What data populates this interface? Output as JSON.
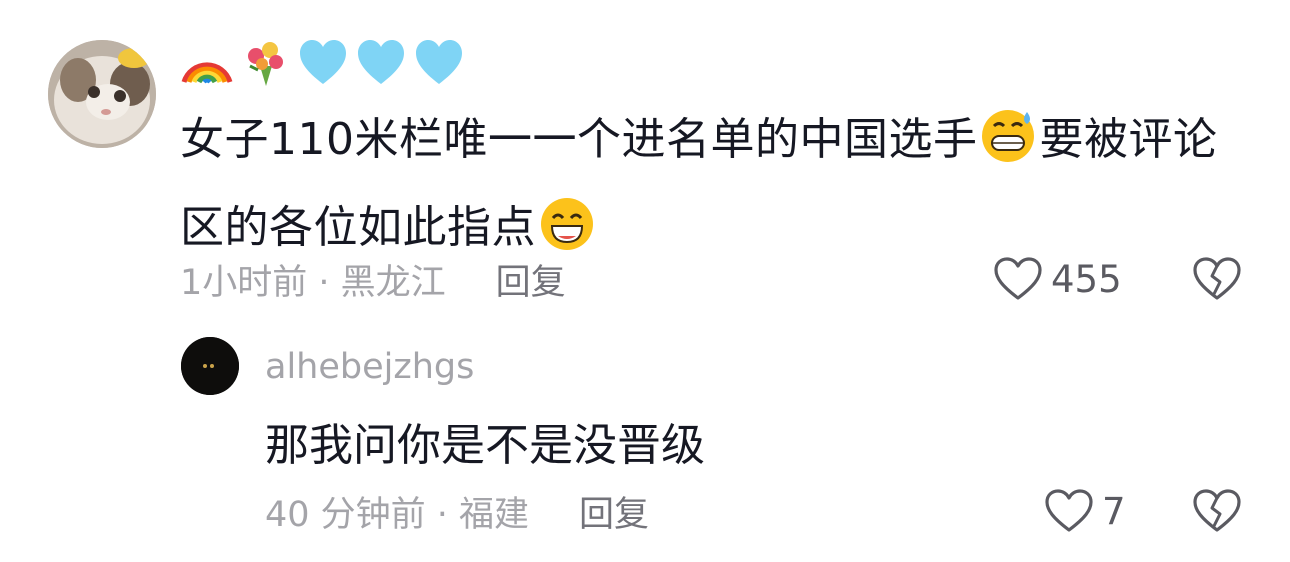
{
  "comment": {
    "avatar_icon": "cat-avatar-icon",
    "emoji_line": [
      "rainbow-icon",
      "bouquet-icon",
      "light-blue-heart-icon",
      "light-blue-heart-icon",
      "light-blue-heart-icon"
    ],
    "text_part1": "女子110米栏唯一一个进名单的中国选手",
    "emoji_mid": "grinning-sweat-emoji",
    "text_part2": "要被评论区的各位如此指点",
    "emoji_end": "grinning-smiling-eyes-emoji",
    "time_location": "1小时前 · 黑龙江",
    "reply_label": "回复",
    "likes": "455",
    "like_icon": "heart-outline-icon",
    "dislike_icon": "broken-heart-icon"
  },
  "reply": {
    "avatar_icon": "dark-avatar-icon",
    "username": "alhebejzhgs",
    "text": "那我问你是不是没晋级",
    "time_location": "40 分钟前 · 福建",
    "reply_label": "回复",
    "likes": "7"
  },
  "colors": {
    "text_primary": "#161823",
    "text_meta": "#a4a4a9",
    "reply_link": "#73737a",
    "icon_stroke": "#5a5a61"
  }
}
